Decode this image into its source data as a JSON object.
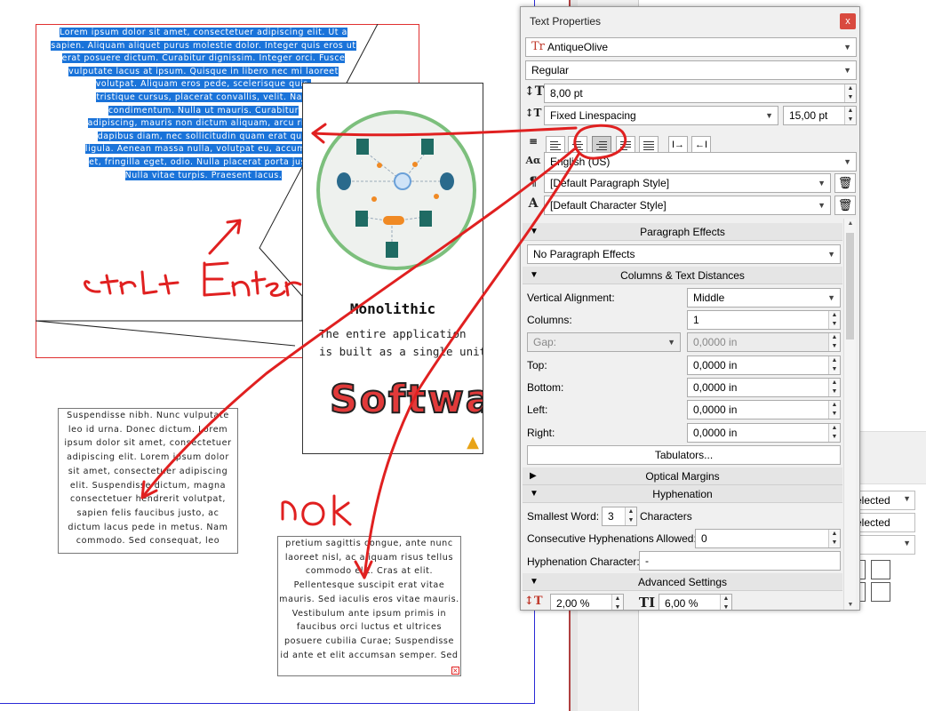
{
  "canvas": {
    "selected_text_lines": [
      "Lorem ipsum dolor sit amet, consectetuer adipiscing elit. Ut a",
      "sapien. Aliquam aliquet purus molestie dolor. Integer quis eros ut",
      "erat posuere dictum. Curabitur dignissim. Integer orci. Fusce",
      "vulputate lacus at ipsum. Quisque in libero nec mi laoreet",
      "volutpat. Aliquam eros pede, scelerisque quis,",
      "tristique cursus, placerat convallis, velit. Nam",
      "condimentum. Nulla ut mauris. Curabitur",
      "adipiscing, mauris non dictum aliquam, arcu risus",
      "dapibus diam, nec sollicitudin quam erat quis",
      "ligula. Aenean massa nulla, volutpat eu, accumsan",
      "et, fringilla eget, odio. Nulla placerat porta justo.",
      "Nulla vitae turpis. Praesent lacus."
    ],
    "frame_left_lines": [
      "Suspendisse nibh. Nunc vulputate",
      "leo id urna. Donec dictum. Lorem",
      "ipsum dolor sit amet, consectetuer",
      "adipiscing elit. Lorem ipsum dolor",
      "sit amet, consectetuer adipiscing",
      "elit. Suspendisse dictum, magna",
      "consectetuer hendrerit volutpat,",
      "sapien felis faucibus justo, ac",
      "dictum lacus pede in metus. Nam",
      "commodo. Sed consequat, leo"
    ],
    "frame_right_lines": [
      "pretium sagittis congue, ante nunc",
      "laoreet nisl, ac aliquam risus tellus",
      "commodo elit. Cras at elit.",
      "Pellentesque suscipit erat vitae",
      "mauris. Sed iaculis eros vitae mauris.",
      "Vestibulum ante ipsum primis in",
      "faucibus orci luctus et ultrices",
      "posuere cubilia Curae; Suspendisse",
      "id ante et elit accumsan semper. Sed"
    ],
    "image": {
      "title": "Monolithic",
      "subtitle_line1": "The entire application",
      "subtitle_line2": "is built as a single unit",
      "big_text": "Software"
    },
    "annotations": {
      "ctrl_enter": "Ctrl+Enter",
      "nok": "nOk",
      "color": "#e02020"
    }
  },
  "background_panel": {
    "select1": "elected",
    "field1": "elected"
  },
  "panel": {
    "title": "Text Properties",
    "close": "x",
    "font": "AntiqueOlive",
    "style": "Regular",
    "size": "8,00 pt",
    "linespacing_mode": "Fixed Linespacing",
    "linespacing_value": "15,00 pt",
    "language": "English (US)",
    "paragraph_style": "[Default Paragraph Style]",
    "character_style": "[Default Character Style]",
    "paragraph_effects": {
      "header": "Paragraph Effects",
      "value": "No Paragraph Effects"
    },
    "columns": {
      "header": "Columns & Text Distances",
      "vertical_alignment_label": "Vertical Alignment:",
      "vertical_alignment": "Middle",
      "columns_label": "Columns:",
      "columns": "1",
      "gap_label": "Gap:",
      "gap_value": "0,0000 in",
      "top_label": "Top:",
      "top": "0,0000 in",
      "bottom_label": "Bottom:",
      "bottom": "0,0000 in",
      "left_label": "Left:",
      "left": "0,0000 in",
      "right_label": "Right:",
      "right": "0,0000 in",
      "tabulators": "Tabulators..."
    },
    "optical_margins": "Optical Margins",
    "hyphenation": {
      "header": "Hyphenation",
      "smallest_word_label": "Smallest Word:",
      "smallest_word": "3",
      "characters_label": "Characters",
      "consecutive_label": "Consecutive Hyphenations Allowed:",
      "consecutive": "0",
      "char_label": "Hyphenation Character:",
      "char": "-"
    },
    "advanced": {
      "header": "Advanced Settings",
      "value1": "2,00 %",
      "value2": "6,00 %"
    }
  }
}
